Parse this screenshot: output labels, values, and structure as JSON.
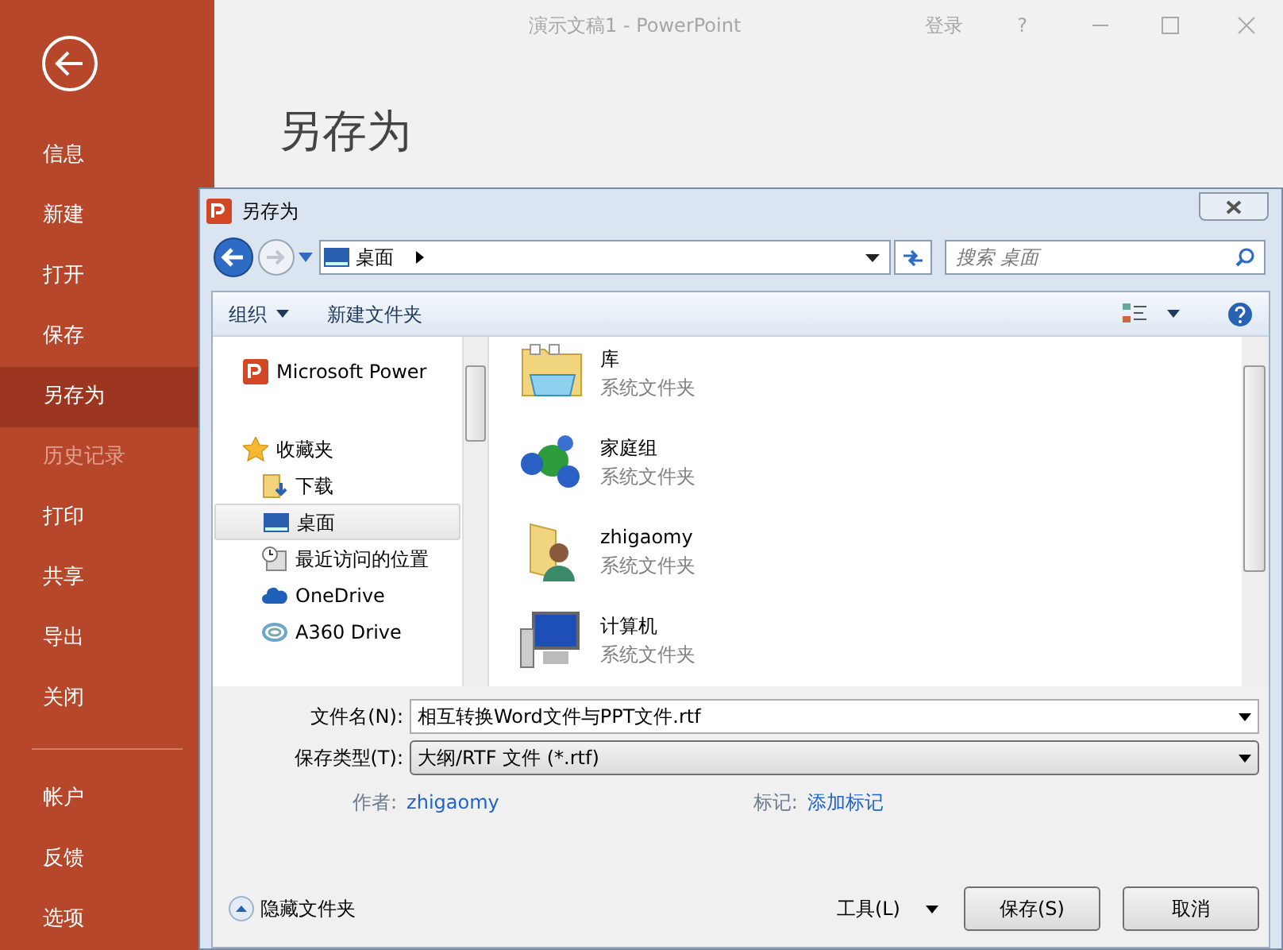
{
  "app_window": {
    "title": "演示文稿1 - PowerPoint",
    "sign_in": "登录",
    "help": "?"
  },
  "backstage_nav": [
    {
      "label": "信息",
      "selected": false,
      "disabled": false
    },
    {
      "label": "新建",
      "selected": false,
      "disabled": false
    },
    {
      "label": "打开",
      "selected": false,
      "disabled": false
    },
    {
      "label": "保存",
      "selected": false,
      "disabled": false
    },
    {
      "label": "另存为",
      "selected": true,
      "disabled": false
    },
    {
      "label": "历史记录",
      "selected": false,
      "disabled": true
    },
    {
      "label": "打印",
      "selected": false,
      "disabled": false
    },
    {
      "label": "共享",
      "selected": false,
      "disabled": false
    },
    {
      "label": "导出",
      "selected": false,
      "disabled": false
    },
    {
      "label": "关闭",
      "selected": false,
      "disabled": false
    }
  ],
  "backstage_nav_bottom": [
    {
      "label": "帐户",
      "selected": false,
      "disabled": false
    },
    {
      "label": "反馈",
      "selected": false,
      "disabled": false
    },
    {
      "label": "选项",
      "selected": false,
      "disabled": false
    }
  ],
  "page_title": "另存为",
  "dialog": {
    "title": "另存为",
    "address": "桌面",
    "search": {
      "placeholder": "搜索 桌面"
    },
    "toolbar": [
      "组织",
      "新建文件夹"
    ],
    "nav_tree": [
      {
        "label": "Microsoft Power",
        "kind": "app",
        "selected": false
      },
      {
        "label": "收藏夹",
        "kind": "favorites",
        "selected": false,
        "children": [
          {
            "label": "下载",
            "kind": "downloads",
            "selected": false
          },
          {
            "label": "桌面",
            "kind": "desktop",
            "selected": true
          },
          {
            "label": "最近访问的位置",
            "kind": "recent",
            "selected": false
          },
          {
            "label": "OneDrive",
            "kind": "cloud",
            "selected": false
          },
          {
            "label": "A360 Drive",
            "kind": "a360",
            "selected": false
          }
        ]
      }
    ],
    "files": [
      {
        "name": "库",
        "type": "系统文件夹",
        "kind": "library"
      },
      {
        "name": "家庭组",
        "type": "系统文件夹",
        "kind": "homegroup"
      },
      {
        "name": "zhigaomy",
        "type": "系统文件夹",
        "kind": "user"
      },
      {
        "name": "计算机",
        "type": "系统文件夹",
        "kind": "computer"
      }
    ],
    "file_name": {
      "label": "文件名(N):",
      "value": "相互转换Word文件与PPT文件.rtf"
    },
    "file_type": {
      "label": "保存类型(T):",
      "value": "大纲/RTF 文件 (*.rtf)"
    },
    "author": {
      "label": "作者:",
      "value": "zhigaomy"
    },
    "tags": {
      "label": "标记:",
      "value": "添加标记"
    },
    "hide_folders": "隐藏文件夹",
    "tools": "工具(L)",
    "buttons": [
      "保存(S)",
      "取消"
    ]
  }
}
